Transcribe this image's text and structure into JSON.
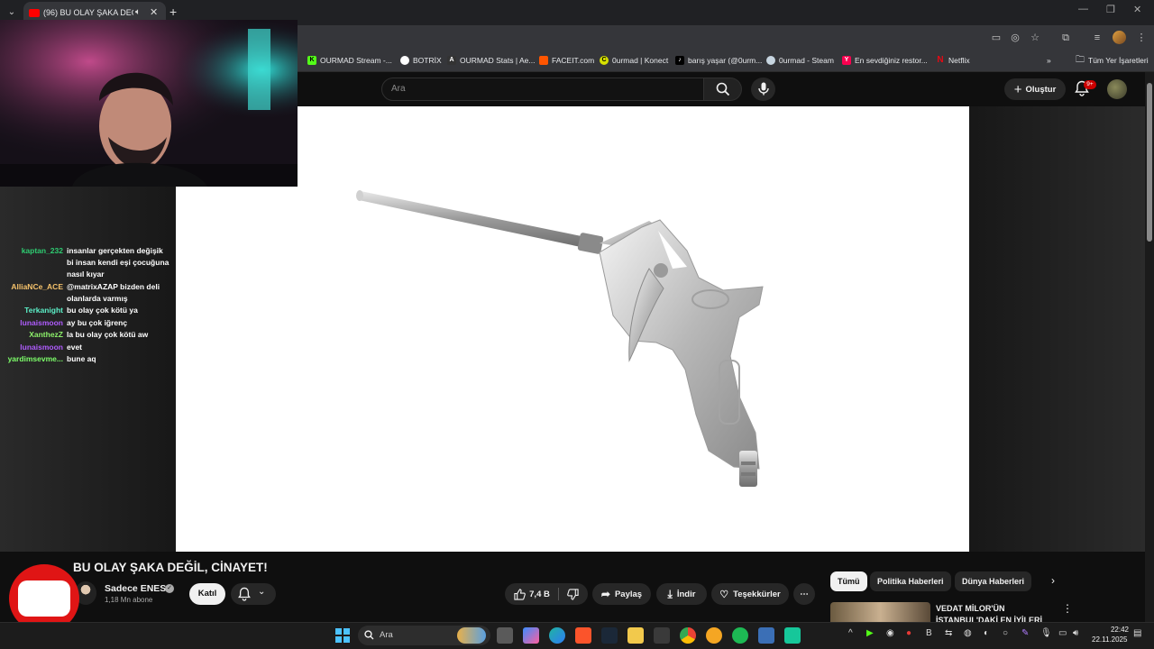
{
  "browser": {
    "tab_title": "(96) BU OLAY ŞAKA DEĞİL, CİNAYET! - YouTube",
    "tab_audio_icon": "speaker-icon",
    "bookmarks": [
      {
        "label": "OURMAD Stream -...",
        "icon": "kick-icon",
        "color": "#53fc18"
      },
      {
        "label": "BOTRİX",
        "icon": "botrix-icon",
        "color": "#ffffff"
      },
      {
        "label": "OURMAD Stats | Ae...",
        "icon": "stats-icon",
        "color": "#ffffff"
      },
      {
        "label": "FACEIT.com",
        "icon": "faceit-icon",
        "color": "#ff5500"
      },
      {
        "label": "0urmad | Konect",
        "icon": "konect-icon",
        "color": "#d6e000"
      },
      {
        "label": "barış yaşar (@0urm...",
        "icon": "tiktok-icon",
        "color": "#ffffff"
      },
      {
        "label": "0urmad - Steam",
        "icon": "steam-icon",
        "color": "#c7d5e0"
      },
      {
        "label": "En sevdiğiniz restor...",
        "icon": "yemeksepeti-icon",
        "color": "#fa0050"
      },
      {
        "label": "Netflix",
        "icon": "netflix-icon",
        "color": "#e50914"
      }
    ],
    "all_bookmarks_label": "Tüm Yer İşaretleri"
  },
  "header": {
    "search_placeholder": "Ara",
    "create_label": "Oluştur",
    "notification_count": "9+"
  },
  "chat": [
    {
      "user": "kaptan_232",
      "color": "#2ecc71",
      "message": "insanlar gerçekten değişik bi insan kendi eşi çocuğuna nasıl kıyar"
    },
    {
      "user": "AlliaNCe_ACE",
      "color": "#f5c26b",
      "message": "@matrixAZAP bizden deli olanlarda varmış"
    },
    {
      "user": "Terkanight",
      "color": "#5cf0c8",
      "message": "bu olay çok kötü ya"
    },
    {
      "user": "lunaismoon",
      "color": "#b05cff",
      "message": "ay bu çok iğrenç"
    },
    {
      "user": "XanthezZ",
      "color": "#8cf06a",
      "message": "la bu olay çok kötü aw"
    },
    {
      "user": "lunaismoon",
      "color": "#b05cff",
      "message": "evet"
    },
    {
      "user": "yardimsevme...",
      "color": "#7dff6a",
      "message": "bune aq"
    }
  ],
  "video": {
    "title": "BU OLAY ŞAKA DEĞİL, CİNAYET!",
    "channel_name": "Sadece ENES",
    "subscribers": "1,18 Mn abone",
    "join_label": "Katıl",
    "likes": "7,4 B",
    "share_label": "Paylaş",
    "download_label": "İndir",
    "thanks_label": "Teşekkürler"
  },
  "sidebar": {
    "chips": [
      "Tümü",
      "Politika Haberleri",
      "Dünya Haberleri"
    ],
    "rec_title": "VEDAT MİLOR'ÜN İSTANBUL'DAKİ EN İYİLERİ"
  },
  "taskbar": {
    "search_placeholder": "Ara",
    "time": "22:42",
    "date": "22.11.2025"
  }
}
